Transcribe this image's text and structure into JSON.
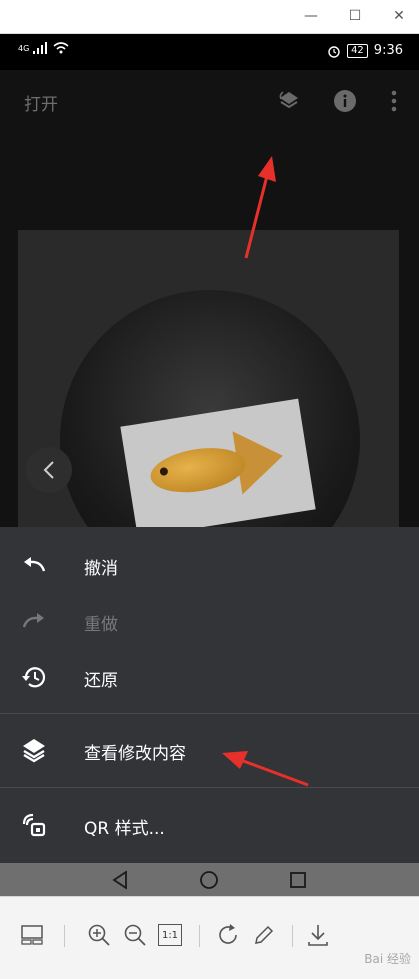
{
  "window": {
    "minimize_glyph": "—",
    "maximize_glyph": "☐",
    "close_glyph": "✕"
  },
  "status_bar": {
    "network": "4G",
    "battery": "42",
    "time": "9:36"
  },
  "app_bar": {
    "open_label": "打开",
    "icons": [
      "layers-sync-icon",
      "info-icon",
      "more-vert-icon"
    ]
  },
  "menu": {
    "items": [
      {
        "label": "撤消",
        "icon": "undo-icon",
        "enabled": true
      },
      {
        "label": "重做",
        "icon": "redo-icon",
        "enabled": false
      },
      {
        "label": "还原",
        "icon": "restore-history-icon",
        "enabled": true
      },
      {
        "label": "查看修改内容",
        "icon": "layers-icon",
        "enabled": true
      },
      {
        "label": "QR 样式...",
        "icon": "qr-style-icon",
        "enabled": true
      }
    ]
  },
  "toolbar": {
    "icons": [
      "layout-icon",
      "zoom-in-icon",
      "zoom-out-icon",
      "actual-size-icon",
      "rotate-icon",
      "edit-icon",
      "download-icon"
    ],
    "actual_size_label": "1:1"
  },
  "watermark": "Bai 经验",
  "colors": {
    "sheet_bg": "#333438",
    "annotation_arrow": "#e8302a"
  }
}
